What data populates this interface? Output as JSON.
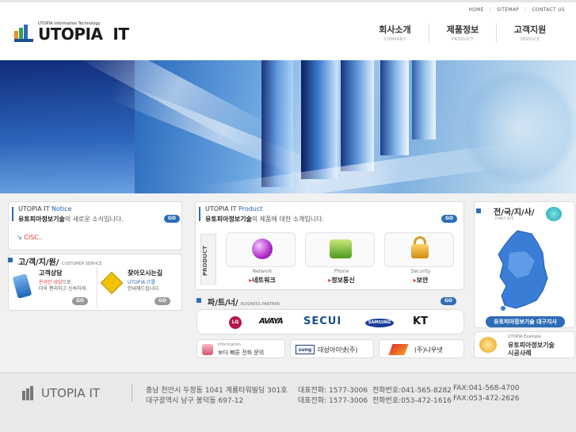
{
  "header": {
    "top_links": [
      "HOME",
      "SITEMAP",
      "CONTACT US"
    ],
    "logo_small": "UTOPIA Information Technology",
    "logo_text": "UTOPIA  IT",
    "menu": [
      {
        "ko": "회사소개",
        "en": "COMPANY"
      },
      {
        "ko": "제품정보",
        "en": "PRODUCT"
      },
      {
        "ko": "고객지원",
        "en": "SERVICE"
      }
    ]
  },
  "notice": {
    "title_prefix": "UTOPIA IT",
    "title_accent": "Notice",
    "subtitle_bold": "유토피아정보기술",
    "subtitle_rest": "의 새로운 소식입니다.",
    "go": "GO",
    "items": [
      "CISC.."
    ]
  },
  "support": {
    "title": "고/객/지/원/",
    "title_en": "CUSTOMER  SERVICE",
    "consult_title": "고객상담",
    "consult_line1_accent": "온라인 상담",
    "consult_line1_rest": "으로",
    "consult_line2": "더욱 편리하고 신속하게.",
    "directions_title": "찾아오시는길",
    "directions_line1": "UTOPIA IT를",
    "directions_line2": "안내해드립니다.",
    "go": "GO"
  },
  "product": {
    "title_prefix": "UTOPIA IT",
    "title_accent": "Product",
    "subtitle_bold": "유토피아정보기술",
    "subtitle_rest": "의 제품에 대한 소개입니다.",
    "go": "GO",
    "side_label": "PRODUCT",
    "items": [
      {
        "en": "Network",
        "ko": "네트워크"
      },
      {
        "en": "Phone",
        "ko": "정보통신"
      },
      {
        "en": "Security",
        "ko": "보안"
      }
    ]
  },
  "partner": {
    "title": "파/트/너/",
    "title_en": "BUSINESS  PARTNER",
    "go": "GO",
    "logos": [
      "LG",
      "AVAYA",
      "SECUI",
      "SAMSUNG",
      "KT"
    ]
  },
  "bottom_links": {
    "info_en": "information",
    "info_ko": "보다 빠른 전화 문의",
    "daesung_mark": "sung",
    "daesung": "대성아이넷(주)",
    "nauneet": "(주)나우넷"
  },
  "branches": {
    "title": "전/국/지/사/",
    "title_en": "FAMILY SITE",
    "button": "유토피아정보기술 대구지사"
  },
  "example": {
    "en": "UTOPIA Example",
    "ko1": "유토피아정보기술",
    "ko2": "시공사례"
  },
  "footer": {
    "logo": "UTOPIA IT",
    "rows": [
      {
        "address": "충남 천안시 두정동 1041 계룡타워빌딩 301호",
        "rep": "대표전화: 1577-3006",
        "tel": "전화번호:041-565-8282",
        "fax": "FAX:041-568-4700"
      },
      {
        "address": "대구광역시 남구 봉덕동 697-12",
        "rep": "대표전화: 1577-3006",
        "tel": "전화번호:053-472-1616",
        "fax": "FAX:053-472-2626"
      }
    ]
  },
  "colors": {
    "accent": "#1e63b5",
    "go_button": "#2e6cb8",
    "notice_item": "#e0342c"
  }
}
